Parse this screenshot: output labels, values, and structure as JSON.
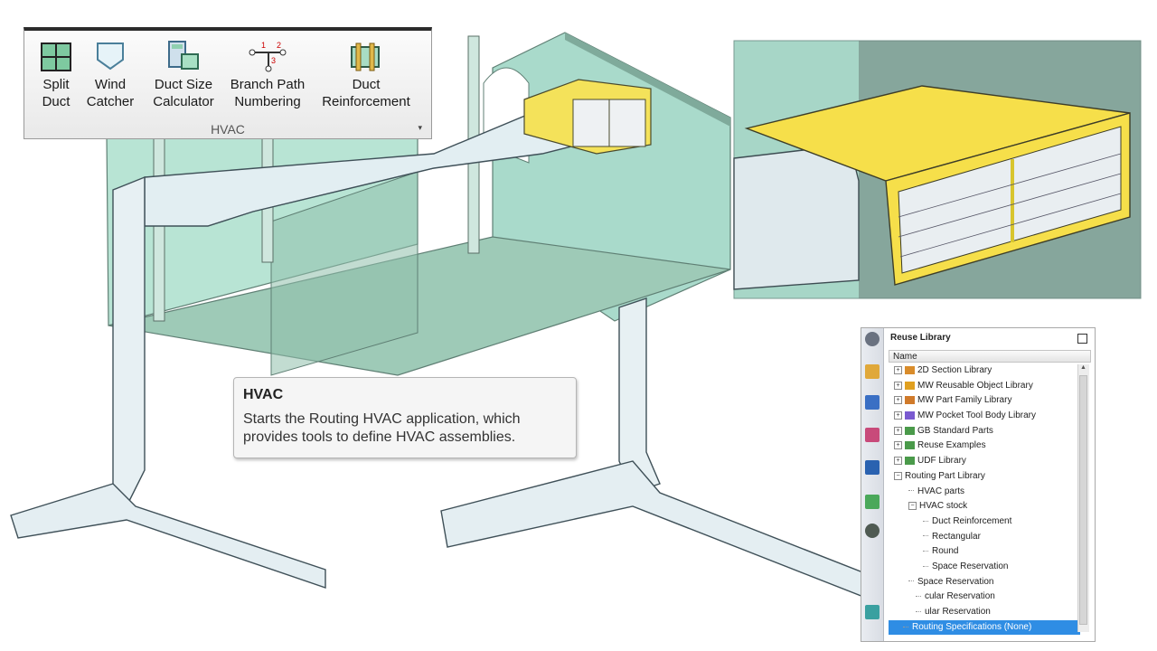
{
  "ribbon": {
    "buttons": [
      {
        "label": "Split\nDuct",
        "icon": "split-duct-icon"
      },
      {
        "label": "Wind\nCatcher",
        "icon": "wind-catcher-icon"
      },
      {
        "label": "Duct Size\nCalculator",
        "icon": "duct-size-calculator-icon"
      },
      {
        "label": "Branch Path\nNumbering",
        "icon": "branch-path-numbering-icon"
      },
      {
        "label": "Duct\nReinforcement",
        "icon": "duct-reinforcement-icon"
      }
    ],
    "group_label": "HVAC",
    "launcher": "▾",
    "branch_numbers": [
      "1",
      "2",
      "3"
    ]
  },
  "tooltip": {
    "title": "HVAC",
    "body": "Starts the Routing HVAC application, which\nprovides tools to define HVAC assemblies."
  },
  "library": {
    "title": "Reuse Library",
    "column_header": "Name",
    "items": [
      {
        "label": "2D Section Library",
        "expander": "+"
      },
      {
        "label": "MW Reusable Object Library",
        "expander": "+"
      },
      {
        "label": "MW Part Family Library",
        "expander": "+"
      },
      {
        "label": "MW Pocket Tool Body Library",
        "expander": "+"
      },
      {
        "label": "GB Standard Parts",
        "expander": "+"
      },
      {
        "label": "Reuse Examples",
        "expander": "+"
      },
      {
        "label": "UDF Library",
        "expander": "+"
      },
      {
        "label": "Routing Part Library",
        "expander": "−"
      },
      {
        "label": "HVAC parts",
        "expander": ""
      },
      {
        "label": "HVAC stock",
        "expander": "−"
      },
      {
        "label": "Duct Reinforcement",
        "expander": ""
      },
      {
        "label": "Rectangular",
        "expander": ""
      },
      {
        "label": "Round",
        "expander": ""
      },
      {
        "label": "Space Reservation",
        "expander": ""
      },
      {
        "label": "Space Reservation",
        "expander": ""
      },
      {
        "label": "cular Reservation",
        "expander": ""
      },
      {
        "label": "ular Reservation",
        "expander": ""
      },
      {
        "label": "Routing Specifications (None)",
        "expander": ""
      }
    ],
    "selected_index": 17,
    "side_icons": [
      "gear-icon",
      "assembly-navigator-icon",
      "constraint-navigator-icon",
      "part-navigator-icon",
      "reuse-library-icon",
      "hd3d-tools-icon",
      "roles-icon",
      "web-browser-icon"
    ]
  },
  "colors": {
    "wall": "#a6d8c6",
    "floor": "#9bc9b5",
    "duct": "#e4eef2",
    "grille": "#f5e35a"
  }
}
